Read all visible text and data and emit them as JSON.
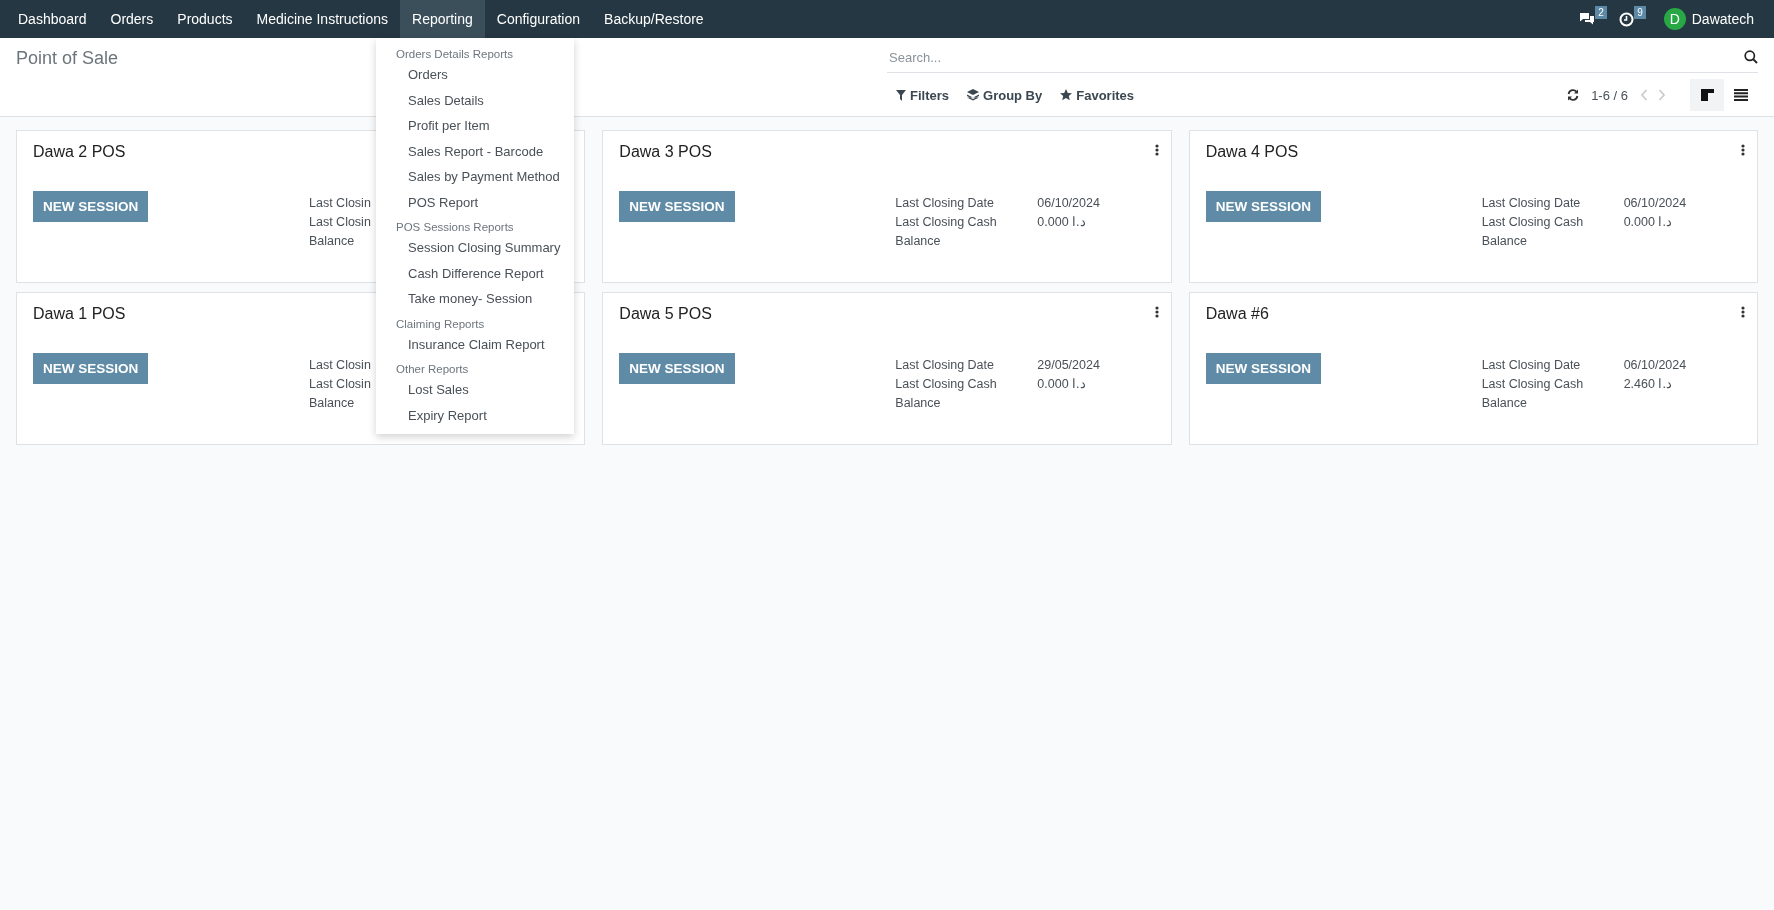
{
  "navbar": {
    "menu": [
      {
        "label": "Dashboard",
        "selected": false
      },
      {
        "label": "Orders",
        "selected": false
      },
      {
        "label": "Products",
        "selected": false
      },
      {
        "label": "Medicine Instructions",
        "selected": false
      },
      {
        "label": "Reporting",
        "selected": true
      },
      {
        "label": "Configuration",
        "selected": false
      },
      {
        "label": "Backup/Restore",
        "selected": false
      }
    ],
    "messages_count": "2",
    "activities_count": "9",
    "user": {
      "initial": "D",
      "name": "Dawatech"
    }
  },
  "control_panel": {
    "title": "Point of Sale",
    "search": {
      "placeholder": "Search..."
    },
    "filters": [
      {
        "kind": "filter",
        "label": "Filters"
      },
      {
        "kind": "group",
        "label": "Group By"
      },
      {
        "kind": "favorite",
        "label": "Favorites"
      }
    ],
    "pager": "1-6 / 6",
    "views": [
      {
        "kind": "kanban",
        "selected": true
      },
      {
        "kind": "list",
        "selected": false
      }
    ]
  },
  "cards": [
    {
      "title": "Dawa 2 POS",
      "button": "NEW SESSION",
      "options_menu": false,
      "rows": [
        {
          "label": "Last Closin"
        },
        {
          "label": "Last Closin"
        },
        {
          "label": "Balance"
        }
      ]
    },
    {
      "title": "Dawa 3 POS",
      "button": "NEW SESSION",
      "options_menu": true,
      "rows": [
        {
          "label": "Last Closing Date",
          "value": "06/10/2024"
        },
        {
          "label": "Last Closing Cash",
          "value": "0.000 د.ا"
        },
        {
          "label": "Balance"
        }
      ]
    },
    {
      "title": "Dawa 4 POS",
      "button": "NEW SESSION",
      "options_menu": true,
      "rows": [
        {
          "label": "Last Closing Date",
          "value": "06/10/2024"
        },
        {
          "label": "Last Closing Cash",
          "value": "0.000 د.ا"
        },
        {
          "label": "Balance"
        }
      ]
    },
    {
      "title": "Dawa 1 POS",
      "button": "NEW SESSION",
      "options_menu": false,
      "rows": [
        {
          "label": "Last Closin"
        },
        {
          "label": "Last Closin"
        },
        {
          "label": "Balance"
        }
      ]
    },
    {
      "title": "Dawa 5 POS",
      "button": "NEW SESSION",
      "options_menu": true,
      "rows": [
        {
          "label": "Last Closing Date",
          "value": "29/05/2024"
        },
        {
          "label": "Last Closing Cash",
          "value": "0.000 د.ا"
        },
        {
          "label": "Balance"
        }
      ]
    },
    {
      "title": "Dawa #6",
      "button": "NEW SESSION",
      "options_menu": true,
      "rows": [
        {
          "label": "Last Closing Date",
          "value": "06/10/2024"
        },
        {
          "label": "Last Closing Cash",
          "value": "2.460 د.ا"
        },
        {
          "label": "Balance"
        }
      ]
    }
  ],
  "reporting_menu": [
    {
      "header": "Orders Details Reports",
      "items": [
        "Orders",
        "Sales Details",
        "Profit per Item",
        "Sales Report - Barcode",
        "Sales by Payment Method",
        "POS Report"
      ]
    },
    {
      "header": "POS Sessions Reports",
      "items": [
        "Session Closing Summary",
        "Cash Difference Report",
        "Take money- Session"
      ]
    },
    {
      "header": "Claiming Reports",
      "items": [
        "Insurance Claim Report"
      ]
    },
    {
      "header": "Other Reports",
      "items": [
        "Lost Sales",
        "Expiry Report"
      ]
    }
  ]
}
